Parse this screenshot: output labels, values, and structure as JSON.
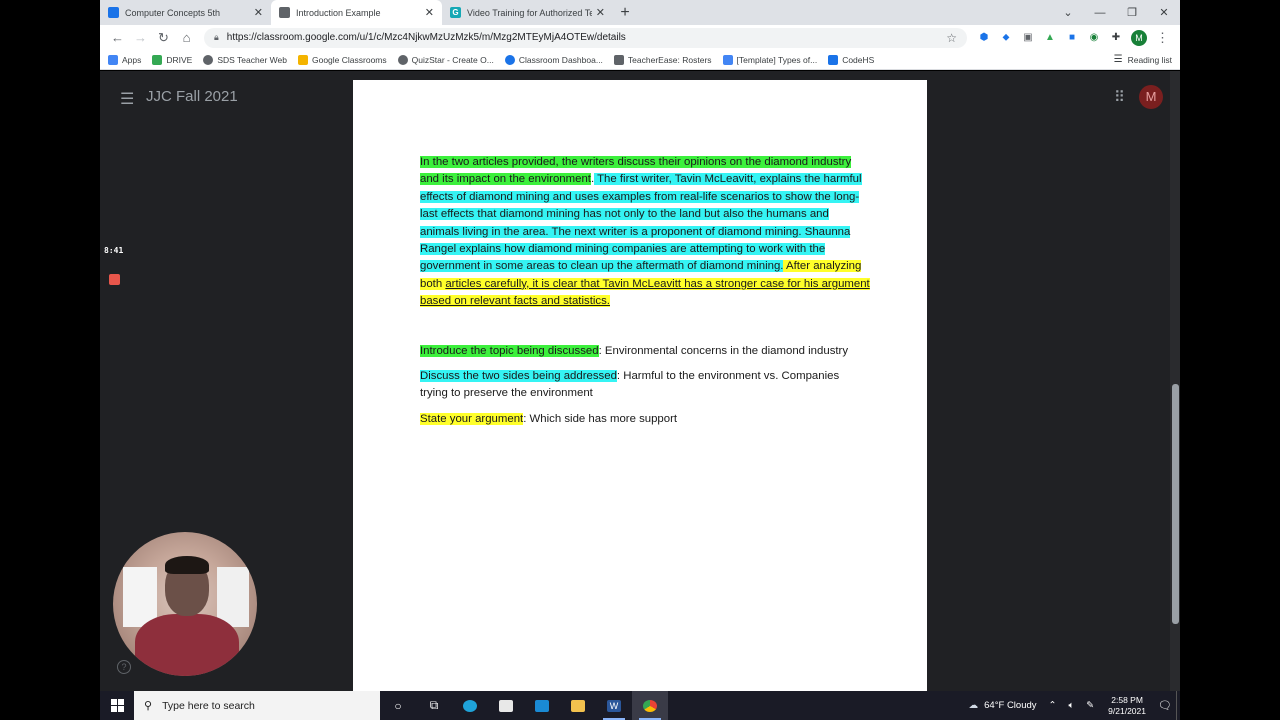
{
  "browser": {
    "tabs": [
      {
        "label": "Computer Concepts 5th",
        "icon_color": "#1a73e8",
        "icon_glyph": "",
        "active": false
      },
      {
        "label": "Introduction Example",
        "icon_color": "#5f6368",
        "icon_glyph": "",
        "active": true
      },
      {
        "label": "Video Training for Authorized Te",
        "icon_color": "#15a8b5",
        "icon_glyph": "G",
        "active": false
      }
    ],
    "url": "https://classroom.google.com/u/1/c/Mzc4NjkwMzUzMzk5/m/Mzg2MTEyMjA4OTEw/details",
    "profile_initial": "M",
    "bookmarks": [
      {
        "label": "Apps",
        "color": "#4285f4"
      },
      {
        "label": "DRIVE",
        "color": "#34a853"
      },
      {
        "label": "SDS Teacher Web",
        "color": "#5f6368"
      },
      {
        "label": "Google Classrooms",
        "color": "#f4b400"
      },
      {
        "label": "QuizStar - Create O...",
        "color": "#5f6368"
      },
      {
        "label": "Classroom Dashboa...",
        "color": "#1a73e8"
      },
      {
        "label": "TeacherEase: Rosters",
        "color": "#5f6368"
      },
      {
        "label": "[Template] Types of...",
        "color": "#4285f4"
      },
      {
        "label": "CodeHS",
        "color": "#1a73e8"
      }
    ],
    "reading_list": "Reading list"
  },
  "classroom": {
    "title": "JJC Fall 2021",
    "avatar_initial": "M"
  },
  "recorder": {
    "timer": "8:41"
  },
  "document": {
    "p1_green": "In the two articles provided, the writers discuss their opinions on the diamond industry and its impact on the environment",
    "p1_green_end": ".",
    "p1_cyan": " The first writer, Tavin McLeavitt, explains the harmful effects of diamond mining and uses examples from real-life scenarios to show the long-last effects that diamond mining has not  only to the land but also the humans and animals living in the area.  The next writer is a proponent of diamond mining.  Shaunna Rangel explains how diamond mining companies are attempting to work with the government in some areas to clean up the aftermath of diamond mining.",
    "p1_yellow": "  After analyzing both ",
    "p1_yellow_ul": "articles carefully, it is clear that Tavin McLeavitt has a stronger case for his argument based on relevant facts and statistics.",
    "intro_label": "Introduce the topic being discussed",
    "intro_text": ": Environmental concerns in the diamond industry",
    "sides_label": "Discuss the two sides being addressed",
    "sides_text": ": Harmful to the environment vs. Companies trying to preserve the environment",
    "arg_label": "State your argument",
    "arg_text": ": Which side has more support"
  },
  "taskbar": {
    "search_placeholder": "Type here to search",
    "weather": "64°F  Cloudy",
    "time": "2:58 PM",
    "date": "9/21/2021"
  }
}
